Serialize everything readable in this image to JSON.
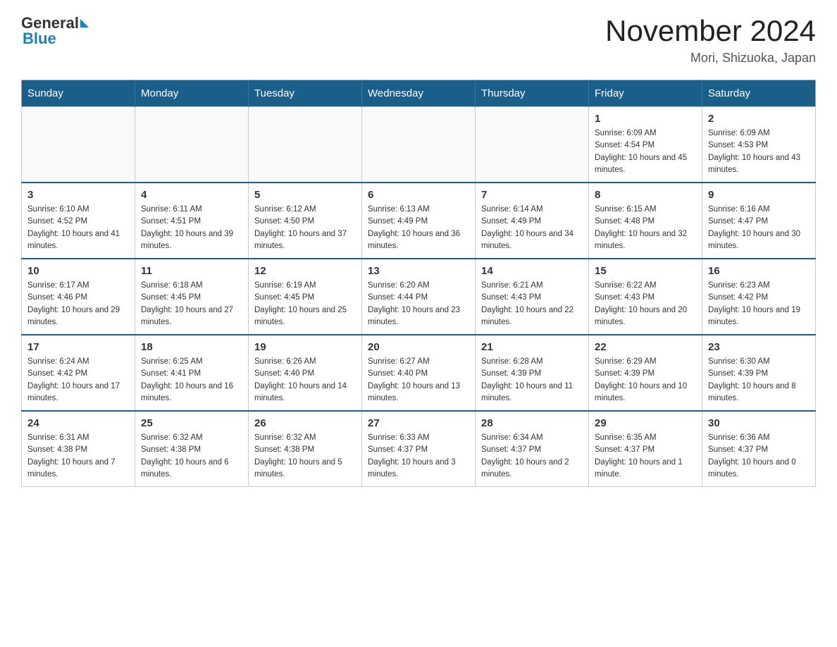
{
  "logo": {
    "general": "General",
    "blue": "Blue"
  },
  "title": "November 2024",
  "subtitle": "Mori, Shizuoka, Japan",
  "weekdays": [
    "Sunday",
    "Monday",
    "Tuesday",
    "Wednesday",
    "Thursday",
    "Friday",
    "Saturday"
  ],
  "weeks": [
    [
      {
        "day": "",
        "info": ""
      },
      {
        "day": "",
        "info": ""
      },
      {
        "day": "",
        "info": ""
      },
      {
        "day": "",
        "info": ""
      },
      {
        "day": "",
        "info": ""
      },
      {
        "day": "1",
        "info": "Sunrise: 6:09 AM\nSunset: 4:54 PM\nDaylight: 10 hours and 45 minutes."
      },
      {
        "day": "2",
        "info": "Sunrise: 6:09 AM\nSunset: 4:53 PM\nDaylight: 10 hours and 43 minutes."
      }
    ],
    [
      {
        "day": "3",
        "info": "Sunrise: 6:10 AM\nSunset: 4:52 PM\nDaylight: 10 hours and 41 minutes."
      },
      {
        "day": "4",
        "info": "Sunrise: 6:11 AM\nSunset: 4:51 PM\nDaylight: 10 hours and 39 minutes."
      },
      {
        "day": "5",
        "info": "Sunrise: 6:12 AM\nSunset: 4:50 PM\nDaylight: 10 hours and 37 minutes."
      },
      {
        "day": "6",
        "info": "Sunrise: 6:13 AM\nSunset: 4:49 PM\nDaylight: 10 hours and 36 minutes."
      },
      {
        "day": "7",
        "info": "Sunrise: 6:14 AM\nSunset: 4:49 PM\nDaylight: 10 hours and 34 minutes."
      },
      {
        "day": "8",
        "info": "Sunrise: 6:15 AM\nSunset: 4:48 PM\nDaylight: 10 hours and 32 minutes."
      },
      {
        "day": "9",
        "info": "Sunrise: 6:16 AM\nSunset: 4:47 PM\nDaylight: 10 hours and 30 minutes."
      }
    ],
    [
      {
        "day": "10",
        "info": "Sunrise: 6:17 AM\nSunset: 4:46 PM\nDaylight: 10 hours and 29 minutes."
      },
      {
        "day": "11",
        "info": "Sunrise: 6:18 AM\nSunset: 4:45 PM\nDaylight: 10 hours and 27 minutes."
      },
      {
        "day": "12",
        "info": "Sunrise: 6:19 AM\nSunset: 4:45 PM\nDaylight: 10 hours and 25 minutes."
      },
      {
        "day": "13",
        "info": "Sunrise: 6:20 AM\nSunset: 4:44 PM\nDaylight: 10 hours and 23 minutes."
      },
      {
        "day": "14",
        "info": "Sunrise: 6:21 AM\nSunset: 4:43 PM\nDaylight: 10 hours and 22 minutes."
      },
      {
        "day": "15",
        "info": "Sunrise: 6:22 AM\nSunset: 4:43 PM\nDaylight: 10 hours and 20 minutes."
      },
      {
        "day": "16",
        "info": "Sunrise: 6:23 AM\nSunset: 4:42 PM\nDaylight: 10 hours and 19 minutes."
      }
    ],
    [
      {
        "day": "17",
        "info": "Sunrise: 6:24 AM\nSunset: 4:42 PM\nDaylight: 10 hours and 17 minutes."
      },
      {
        "day": "18",
        "info": "Sunrise: 6:25 AM\nSunset: 4:41 PM\nDaylight: 10 hours and 16 minutes."
      },
      {
        "day": "19",
        "info": "Sunrise: 6:26 AM\nSunset: 4:40 PM\nDaylight: 10 hours and 14 minutes."
      },
      {
        "day": "20",
        "info": "Sunrise: 6:27 AM\nSunset: 4:40 PM\nDaylight: 10 hours and 13 minutes."
      },
      {
        "day": "21",
        "info": "Sunrise: 6:28 AM\nSunset: 4:39 PM\nDaylight: 10 hours and 11 minutes."
      },
      {
        "day": "22",
        "info": "Sunrise: 6:29 AM\nSunset: 4:39 PM\nDaylight: 10 hours and 10 minutes."
      },
      {
        "day": "23",
        "info": "Sunrise: 6:30 AM\nSunset: 4:39 PM\nDaylight: 10 hours and 8 minutes."
      }
    ],
    [
      {
        "day": "24",
        "info": "Sunrise: 6:31 AM\nSunset: 4:38 PM\nDaylight: 10 hours and 7 minutes."
      },
      {
        "day": "25",
        "info": "Sunrise: 6:32 AM\nSunset: 4:38 PM\nDaylight: 10 hours and 6 minutes."
      },
      {
        "day": "26",
        "info": "Sunrise: 6:32 AM\nSunset: 4:38 PM\nDaylight: 10 hours and 5 minutes."
      },
      {
        "day": "27",
        "info": "Sunrise: 6:33 AM\nSunset: 4:37 PM\nDaylight: 10 hours and 3 minutes."
      },
      {
        "day": "28",
        "info": "Sunrise: 6:34 AM\nSunset: 4:37 PM\nDaylight: 10 hours and 2 minutes."
      },
      {
        "day": "29",
        "info": "Sunrise: 6:35 AM\nSunset: 4:37 PM\nDaylight: 10 hours and 1 minute."
      },
      {
        "day": "30",
        "info": "Sunrise: 6:36 AM\nSunset: 4:37 PM\nDaylight: 10 hours and 0 minutes."
      }
    ]
  ]
}
